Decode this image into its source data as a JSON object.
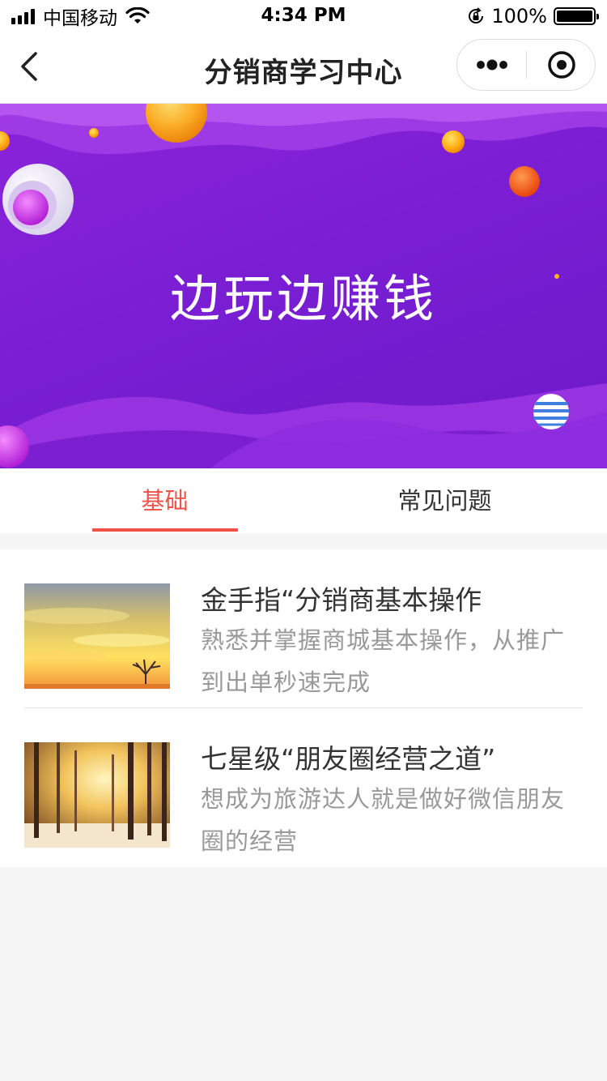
{
  "status_bar": {
    "carrier": "中国移动",
    "time": "4:34 PM",
    "battery_percent": "100%"
  },
  "nav": {
    "title": "分销商学习中心"
  },
  "banner": {
    "title": "边玩边赚钱"
  },
  "tabs": [
    {
      "label": "基础",
      "active": true
    },
    {
      "label": "常见问题",
      "active": false
    }
  ],
  "articles": [
    {
      "title": "金手指“分销商基本操作",
      "desc": "熟悉并掌握商城基本操作，从推广到出单秒速完成",
      "thumbnail": "sunset-sky-tree"
    },
    {
      "title": "七星级“朋友圈经营之道”",
      "desc": "想成为旅游达人就是做好微信朋友圈的经营",
      "thumbnail": "winter-birch-forest"
    }
  ],
  "colors": {
    "accent": "#f0524a",
    "banner_purple": "#7a1ed4",
    "background": "#f5f5f5"
  }
}
